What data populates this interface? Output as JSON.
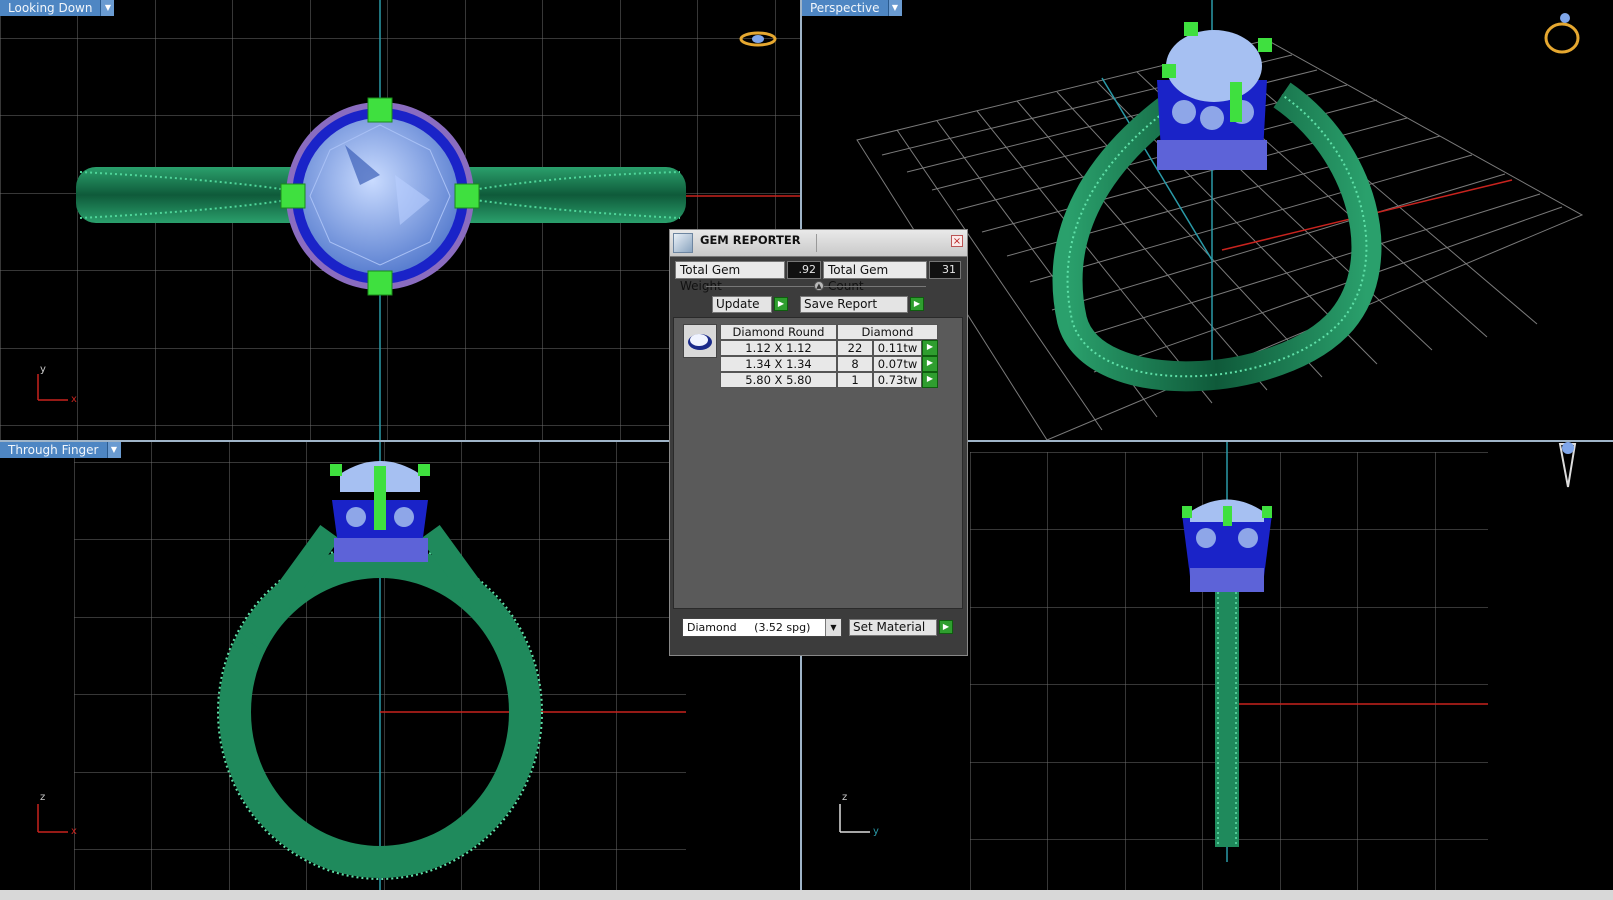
{
  "viewports": {
    "top": {
      "label": "Looking Down",
      "axis_a": "y",
      "axis_b": "x"
    },
    "perspective": {
      "label": "Perspective"
    },
    "front": {
      "label": "Through Finger",
      "axis_a": "z",
      "axis_b": "x"
    },
    "side": {
      "label": "",
      "axis_a": "z",
      "axis_b": "y"
    }
  },
  "gem_reporter": {
    "title": "GEM REPORTER",
    "close": "×",
    "total_weight_label": "Total Gem Weight",
    "total_weight_value": ".92",
    "total_count_label": "Total Gem Count",
    "total_count_value": "31",
    "update_label": "Update",
    "save_report_label": "Save Report",
    "table": {
      "header_shape": "Diamond Round",
      "header_material": "Diamond",
      "rows": [
        {
          "size": "1.12 X 1.12",
          "count": "22",
          "weight": "0.11tw"
        },
        {
          "size": "1.34 X 1.34",
          "count": "8",
          "weight": "0.07tw"
        },
        {
          "size": "5.80 X 5.80",
          "count": "1",
          "weight": "0.73tw"
        }
      ]
    },
    "material_select": "Diamond     (3.52 spg)",
    "set_material_label": "Set Material"
  },
  "colors": {
    "metal": "#1f8a5c",
    "gem": "#7fa6ea",
    "setting": "#1a23c8",
    "prong": "#3fe03f",
    "grid": "#6a6a6a",
    "axis_red": "#c8231e",
    "axis_cyan": "#2a9aa8",
    "label_bg": "#4e86c3"
  }
}
